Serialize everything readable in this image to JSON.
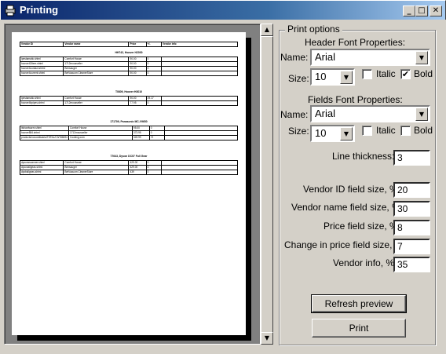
{
  "window": {
    "title": "Printing",
    "min_btn": "_",
    "max_btn": "□",
    "close_btn": "✕"
  },
  "preview": {
    "header": [
      "Vendor ID",
      "Vendor name",
      "Price",
      "+/-",
      "Vendor info"
    ],
    "groups": [
      {
        "title": "HH742, Hoover H2000",
        "rows": [
          [
            "ipestamatic.shtml",
            "Comfort House",
            "90.00",
            "0",
            ""
          ],
          [
            "hoover42item.shtml",
            "1712mousseller",
            "90.00",
            "0",
            ""
          ],
          [
            "hoover4contact.shtml",
            "Bensauger",
            "90.00",
            "0",
            ""
          ],
          [
            "hoover4current.shtml",
            "BetVacuum CleanerStore",
            "90.00",
            "0",
            ""
          ]
        ]
      },
      {
        "title": "T0809, Hoover H3010",
        "rows": [
          [
            "ipestamatic.shtml",
            "Comfort House",
            "90.00",
            "29.17",
            ""
          ],
          [
            "hoover4bpipes.shtml",
            "1712mousseller",
            "77.95",
            "0",
            ""
          ]
        ]
      },
      {
        "title": "171709, Panasonic MC-V9650",
        "rows": [
          [
            "itshardwarm.shtml",
            "Comfort House",
            "95.00",
            "0",
            ""
          ],
          [
            "hoover884.shtml",
            "1712mousseller",
            "373.95",
            "0",
            ""
          ],
          [
            "products/novoddisstria/TEFAL/C3/788694",
            "Cooking.com",
            "349.99",
            "72",
            ""
          ]
        ]
      },
      {
        "title": "77643, Dyson DC07 Full Gear",
        "rows": [
          [
            "dysonsscanner.shtml",
            "Comfort House",
            "429.00",
            "0",
            ""
          ],
          [
            "dysonallgeas.shtml",
            "Bensauger",
            "429.00",
            "0",
            ""
          ],
          [
            "dysballgeas.shtml",
            "BetVacuum CleanerStore",
            "439",
            "0",
            ""
          ]
        ]
      }
    ]
  },
  "scrollbar": {
    "up": "▲",
    "down": "▼"
  },
  "options": {
    "group_title": "Print options",
    "header_font_title": "Header Font Properties:",
    "fields_font_title": "Fields Font Properties:",
    "name_label": "Name:",
    "size_label": "Size:",
    "italic_label": "Italic",
    "bold_label": "Bold",
    "header_font_name": "Arial",
    "header_font_size": "10",
    "header_italic": false,
    "header_bold": true,
    "fields_font_name": "Arial",
    "fields_font_size": "10",
    "fields_italic": false,
    "fields_bold": false,
    "check_mark": "✔",
    "combo_arrow": "▼",
    "line_thickness_label": "Line thickness:",
    "line_thickness": "3",
    "vendor_id_label": "Vendor ID field size, %",
    "vendor_id": "20",
    "vendor_name_label": "Vendor name field size, %",
    "vendor_name": "30",
    "price_label": "Price field size, %",
    "price": "8",
    "change_label": "Change in price field size, %",
    "change": "7",
    "vendor_info_label": "Vendor info, %",
    "vendor_info": "35",
    "refresh_button": "Refresh preview",
    "print_button": "Print"
  }
}
